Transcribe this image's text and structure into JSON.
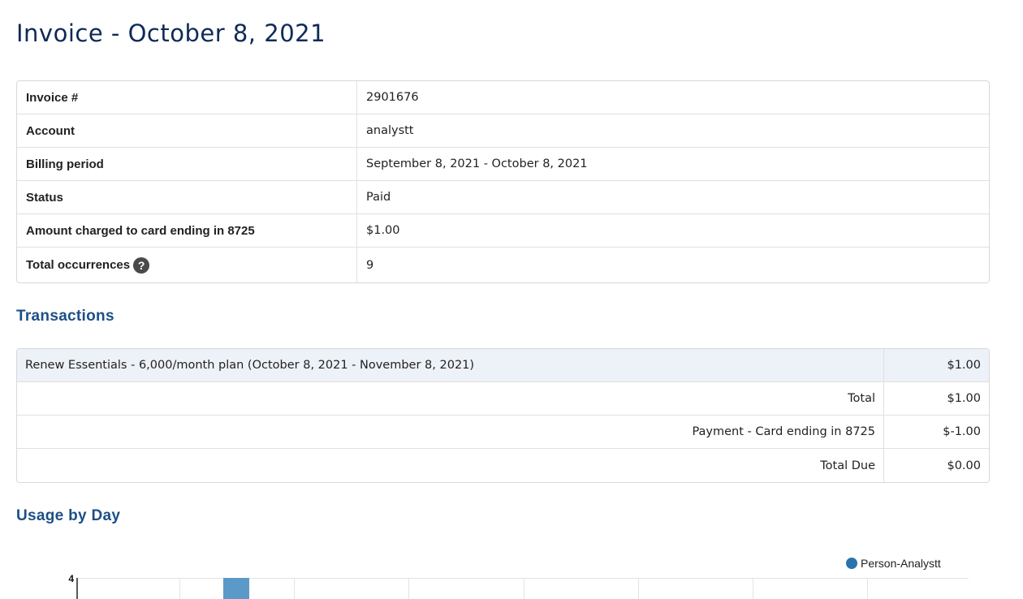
{
  "page": {
    "title": "Invoice - October 8, 2021"
  },
  "invoice": {
    "rows": [
      {
        "label": "Invoice #",
        "value": "2901676"
      },
      {
        "label": "Account",
        "value": "analystt"
      },
      {
        "label": "Billing period",
        "value": "September 8, 2021 - October 8, 2021"
      },
      {
        "label": "Status",
        "value": "Paid"
      },
      {
        "label": "Amount charged to card ending in 8725",
        "value": "$1.00"
      },
      {
        "label": "Total occurrences",
        "value": "9",
        "help": "?"
      }
    ]
  },
  "transactions": {
    "title": "Transactions",
    "rows": [
      {
        "desc": "Renew Essentials - 6,000/month plan (October 8, 2021 - November 8, 2021)",
        "amount": "$1.00"
      },
      {
        "desc": "Total",
        "amount": "$1.00"
      },
      {
        "desc": "Payment - Card ending in 8725",
        "amount": "$-1.00"
      },
      {
        "desc": "Total Due",
        "amount": "$0.00"
      }
    ]
  },
  "usage": {
    "title": "Usage by Day"
  },
  "chart_data": {
    "type": "bar",
    "series": [
      {
        "name": "Person-Analystt",
        "color": "#2a73ad"
      }
    ],
    "y_tick_labels": [
      "4"
    ],
    "ylim_top": 4,
    "visible_bars": [
      4
    ]
  }
}
